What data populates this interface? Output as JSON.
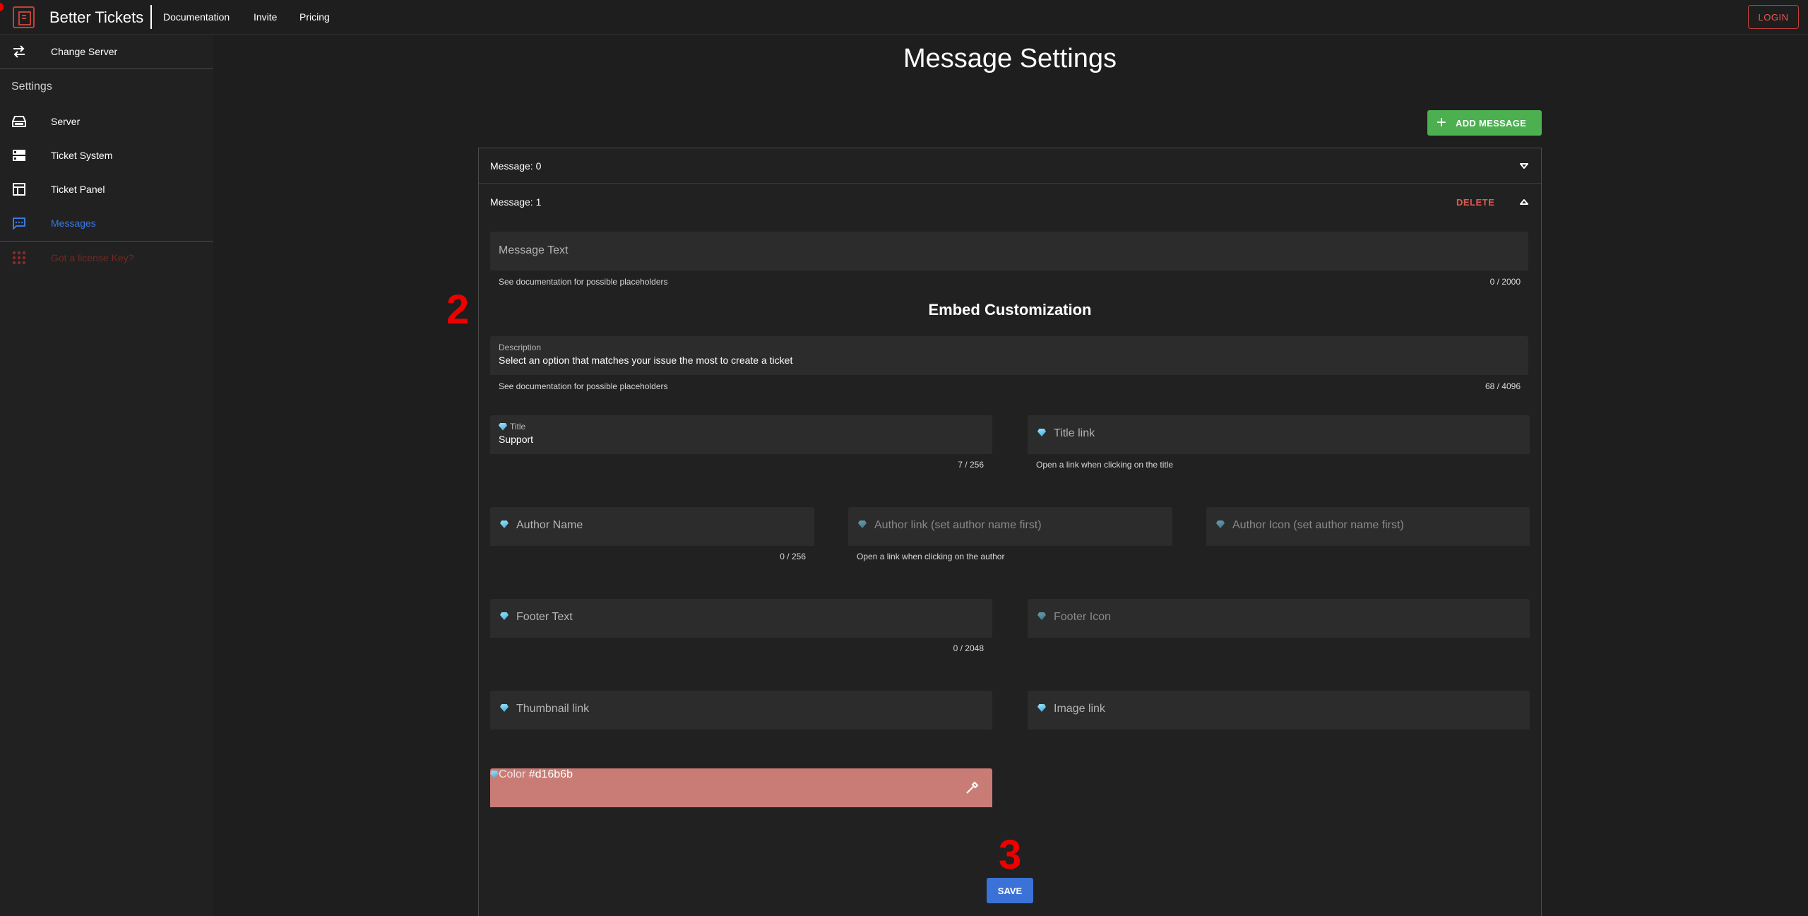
{
  "header": {
    "brand": "Better Tickets",
    "nav": [
      "Documentation",
      "Invite",
      "Pricing"
    ],
    "login_label": "LOGIN"
  },
  "sidebar": {
    "change_server": "Change Server",
    "section_label": "Settings",
    "items": [
      {
        "label": "Server",
        "icon": "server-icon"
      },
      {
        "label": "Ticket System",
        "icon": "ticket-system-icon"
      },
      {
        "label": "Ticket Panel",
        "icon": "ticket-panel-icon"
      },
      {
        "label": "Messages",
        "icon": "messages-icon",
        "active": true
      }
    ],
    "license_label": "Got a license Key?"
  },
  "main": {
    "title": "Message Settings",
    "add_message_label": "ADD MESSAGE",
    "messages": [
      {
        "label": "Message: 0",
        "expanded": false
      },
      {
        "label": "Message: 1",
        "expanded": true,
        "delete_label": "DELETE"
      }
    ],
    "form": {
      "message_text": {
        "placeholder": "Message Text",
        "hint": "See documentation for possible placeholders",
        "count": "0 / 2000"
      },
      "embed_title": "Embed Customization",
      "description": {
        "label": "Description",
        "value": "Select an option that matches your issue the most to create a ticket",
        "hint": "See documentation for possible placeholders",
        "count": "68 / 4096"
      },
      "title": {
        "label": "Title",
        "value": "Support",
        "count": "7 / 256"
      },
      "title_link": {
        "placeholder": "Title link",
        "hint": "Open a link when clicking on the title"
      },
      "author_name": {
        "placeholder": "Author Name",
        "count": "0 / 256"
      },
      "author_link": {
        "placeholder": "Author link (set author name first)",
        "hint": "Open a link when clicking on the author"
      },
      "author_icon": {
        "placeholder": "Author Icon (set author name first)"
      },
      "footer_text": {
        "placeholder": "Footer Text",
        "count": "0 / 2048"
      },
      "footer_icon": {
        "placeholder": "Footer Icon"
      },
      "thumbnail_link": {
        "placeholder": "Thumbnail link"
      },
      "image_link": {
        "placeholder": "Image link"
      },
      "color": {
        "label": "Color",
        "value": "#d16b6b"
      },
      "save_label": "SAVE"
    }
  },
  "annotations": [
    "2",
    "3"
  ],
  "colors": {
    "accent_red": "#c0413a",
    "add_green": "#4caf50",
    "save_blue": "#3a72d8",
    "active_blue": "#3a78e0",
    "embed_color": "#d16b6b"
  }
}
